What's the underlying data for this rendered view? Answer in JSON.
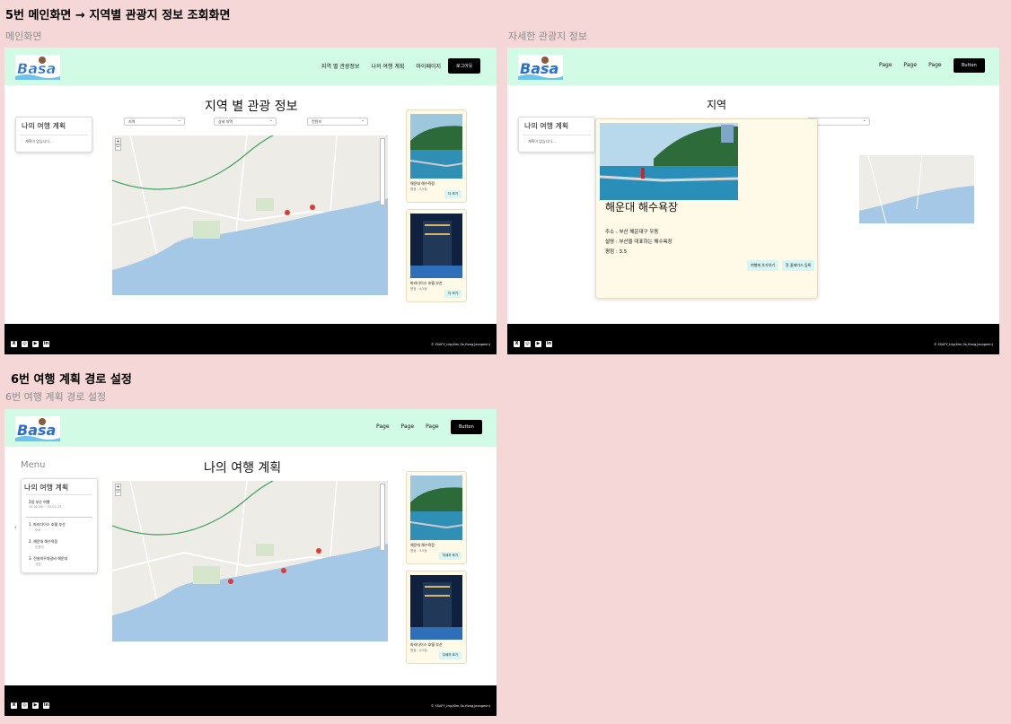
{
  "sections": {
    "s5_title": "5번 메인화면 → 지역별 관광지 정보 조회화면",
    "s5_left_label": "메인화면",
    "s5_right_label": "자세한 관광지 정보",
    "s6_title": "6번 여행 계획 경로 설정",
    "s6_label": "6번 여행 계획 경로 설정"
  },
  "logo": {
    "text": "Basa",
    "name": "logo-icon"
  },
  "main": {
    "nav": [
      "지역 별 관광정보",
      "나의 여행 계획",
      "마이페이지"
    ],
    "login_button": "로그아웃",
    "page_title": "지역 별 관광 정보",
    "plan_title": "나의 여행 계획",
    "plan_empty": "계획이 없습니다...",
    "selects": [
      "지역",
      "상세 지역",
      "컨텐츠"
    ],
    "cards": [
      {
        "name": "해운대 해수욕장",
        "rating": "평점 : 3.5점",
        "button": "더 보기"
      },
      {
        "name": "파라다이스 호텔 부산",
        "rating": "평점 : 4.5점",
        "button": "더 보기"
      }
    ],
    "copyright": "© SSAFY_trip(Kim,Sa,Hong,Jeongmin)"
  },
  "detail": {
    "nav": [
      "Page",
      "Page",
      "Page"
    ],
    "button": "Button",
    "page_title": "지역",
    "plan_title": "나의 여행 계획",
    "plan_empty": "계획이 없습니다...",
    "place_title": "해운대 해수욕장",
    "address": "주소 : 부산 해운대구 우동",
    "description": "설명 : 부산을 대표하는 해수욕장",
    "rating": "평점 : 3.5",
    "btn_add_plan": "여행에 추가하기",
    "btn_hotplace": "핫 플레이스 등록",
    "copyright": "© SSAFY_trip(Kim,Sa,Hong,Jeongmin)"
  },
  "route": {
    "nav": [
      "Page",
      "Page",
      "Page"
    ],
    "button": "Button",
    "menu_label": "Menu",
    "page_title": "나의 여행 계획",
    "plan_title": "나의 여행 계획",
    "trip_name": "2일 부산 여행",
    "trip_dates": "25.02.26 ~ 25.02.27",
    "route_items": [
      {
        "label": "1. 파라다이스 호텔 부산",
        "sub": "숙소"
      },
      {
        "label": "2. 해운대 해수욕장",
        "sub": "관광지"
      },
      {
        "label": "3. 전설의우대갈비 해운대",
        "sub": "식당"
      }
    ],
    "chevron": "‹",
    "cards": [
      {
        "name": "해운대 해수욕장",
        "rating": "평점 : 3.5점",
        "button": "자세히 보기"
      },
      {
        "name": "파라다이스 호텔 부산",
        "rating": "평점 : 4.5점",
        "button": "자세히 보기"
      }
    ],
    "copyright": "© SSAFY_trip(Kim,Sa,Hong,Jeongmin)"
  },
  "social_icons": [
    "x-icon",
    "instagram-icon",
    "youtube-icon",
    "linkedin-icon"
  ],
  "colors": {
    "background": "#f6d7d7",
    "header": "#d2fbe5",
    "card": "#fff9e8",
    "card_button": "#d8f6f6",
    "footer": "#000000",
    "sea": "#a5c8e6"
  }
}
